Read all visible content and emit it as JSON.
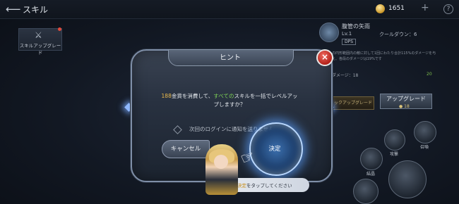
{
  "topbar": {
    "title": "スキル",
    "gold": "1651"
  },
  "left_tab": {
    "label": "スキルアップグレード"
  },
  "skill_panel": {
    "name": "腹管の矢雨",
    "level": "Lv.1",
    "cooldown": "クールダウン：6",
    "tag": "DPS",
    "description": "の円形範囲内の敵に対して1回にわたり合計115%のダメージを与え、各段のダメージは19%です",
    "damage_label": "ダメージ：18",
    "damage_next": "20",
    "upgrade_small": "ックアップグレード",
    "upgrade_button": "アップグレード",
    "upgrade_cost": "18",
    "btn_attack": "攻撃",
    "btn_summon": "召喚",
    "btn_transform": "結晶"
  },
  "dialog": {
    "title": "ヒント",
    "message_gold": "188",
    "message_part1": "金貨を消費して、",
    "message_highlight": "すべての",
    "message_part2": "スキルを一括でレベルアップしますか？",
    "checkbox_label": "次回のログインに通知を送りません",
    "cancel_label": "キャンセル",
    "ok_label": "決定"
  },
  "tutorial": {
    "highlight": "決定",
    "text": "をタップしてください"
  }
}
